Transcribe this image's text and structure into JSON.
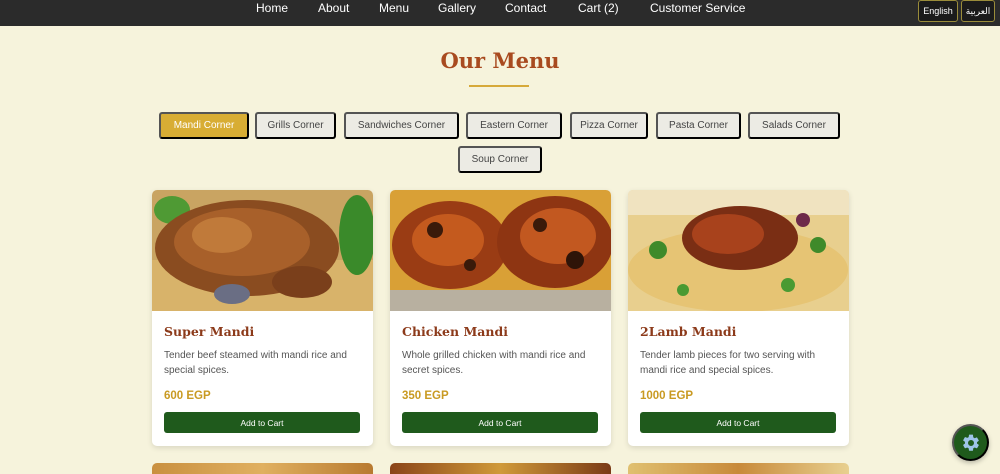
{
  "nav": {
    "items": [
      {
        "label": "Home"
      },
      {
        "label": "About"
      },
      {
        "label": "Menu"
      },
      {
        "label": "Gallery"
      },
      {
        "label": "Contact"
      },
      {
        "label": "Cart (2)"
      },
      {
        "label": "Customer Service"
      }
    ],
    "languages": [
      "English",
      "العربية"
    ]
  },
  "menu": {
    "title": "Our Menu",
    "tabs": [
      {
        "label": "Mandi Corner",
        "active": true
      },
      {
        "label": "Grills Corner",
        "active": false
      },
      {
        "label": "Sandwiches Corner",
        "active": false
      },
      {
        "label": "Eastern Corner",
        "active": false
      },
      {
        "label": "Pizza Corner",
        "active": false
      },
      {
        "label": "Pasta Corner",
        "active": false
      },
      {
        "label": "Salads Corner",
        "active": false
      },
      {
        "label": "Soup Corner",
        "active": false
      }
    ],
    "items": [
      {
        "name": "Super Mandi",
        "description": "Tender beef steamed with mandi rice and special spices.",
        "price": "600 EGP",
        "button": "Add to Cart"
      },
      {
        "name": "Chicken Mandi",
        "description": "Whole grilled chicken with mandi rice and secret spices.",
        "price": "350 EGP",
        "button": "Add to Cart"
      },
      {
        "name": "2Lamb Mandi",
        "description": "Tender lamb pieces for two serving with mandi rice and special spices.",
        "price": "1000 EGP",
        "button": "Add to Cart"
      }
    ]
  },
  "colors": {
    "background": "#f6f3dc",
    "nav_bg": "#2b2b2b",
    "title": "#a84a1f",
    "accent": "#d8ad34",
    "button": "#1f5a1c",
    "price": "#c99a22"
  },
  "icons": {
    "fab": "gear-icon"
  }
}
